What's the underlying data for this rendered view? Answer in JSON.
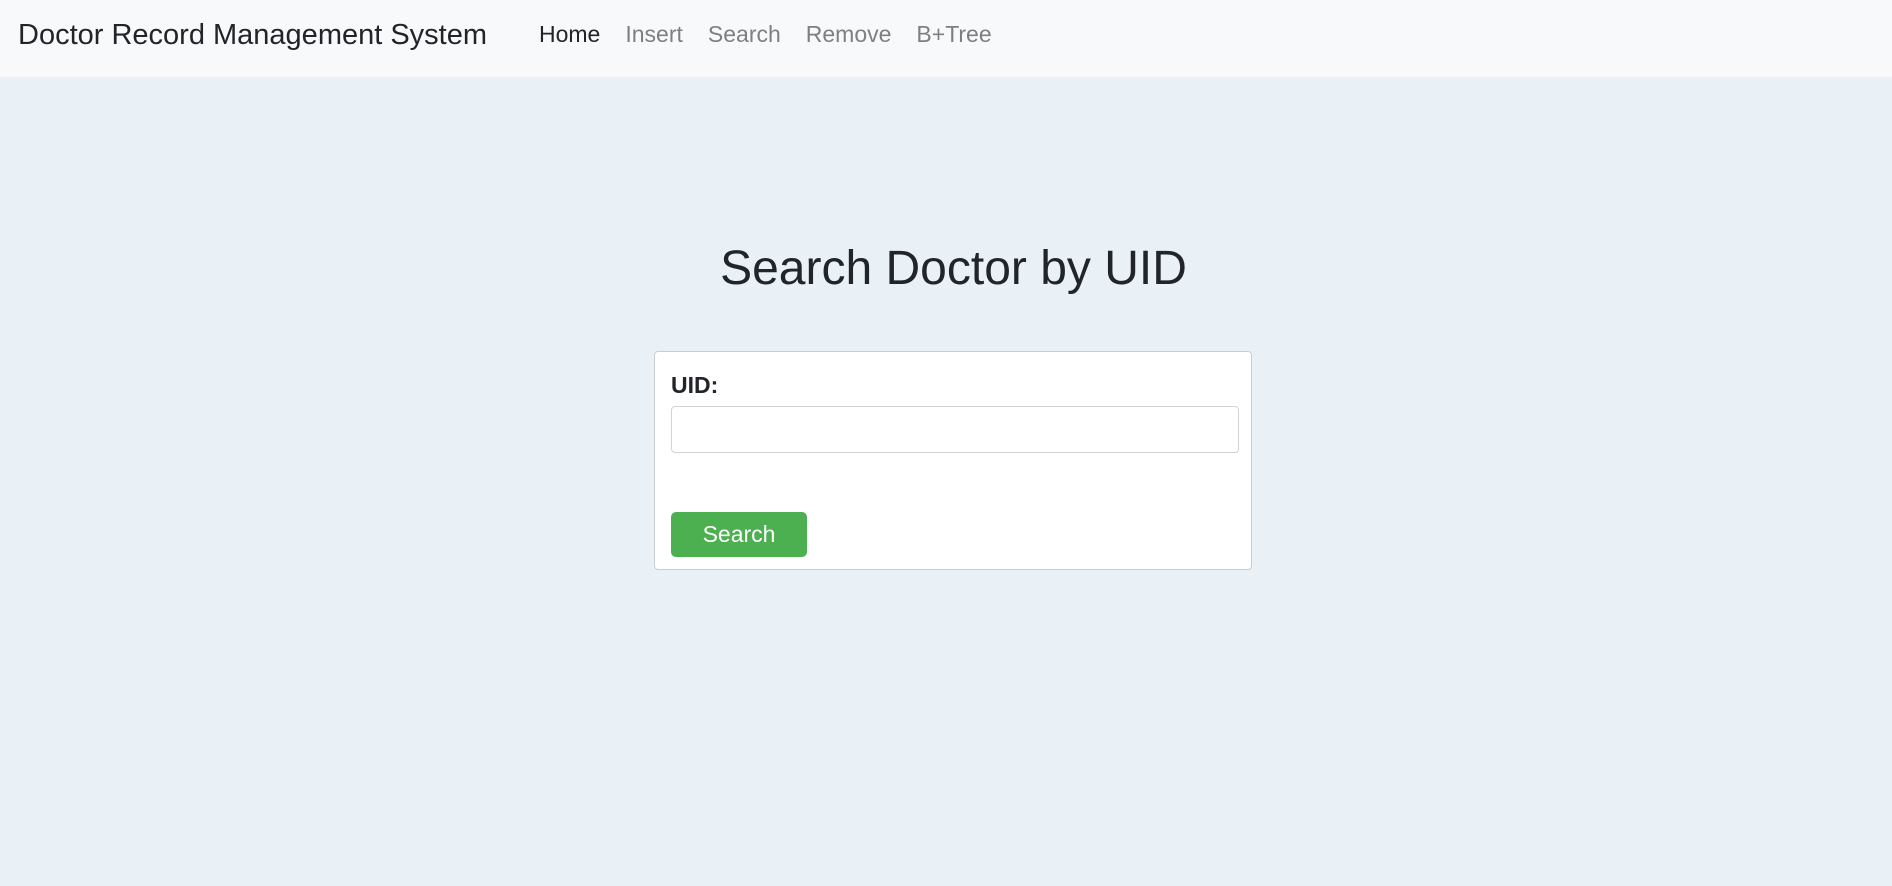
{
  "navbar": {
    "brand": "Doctor Record Management System",
    "links": [
      {
        "label": "Home",
        "active": true
      },
      {
        "label": "Insert",
        "active": false
      },
      {
        "label": "Search",
        "active": false
      },
      {
        "label": "Remove",
        "active": false
      },
      {
        "label": "B+Tree",
        "active": false
      }
    ]
  },
  "main": {
    "title": "Search Doctor by UID",
    "form": {
      "uid_label": "UID:",
      "uid_value": "",
      "uid_placeholder": "",
      "submit_label": "Search"
    }
  },
  "colors": {
    "page_background": "#e9f0f6",
    "navbar_background": "#f8f9fa",
    "button_background": "#4caf50",
    "button_text": "#ffffff",
    "active_link": "#212529",
    "inactive_link": "#7d7f81"
  }
}
